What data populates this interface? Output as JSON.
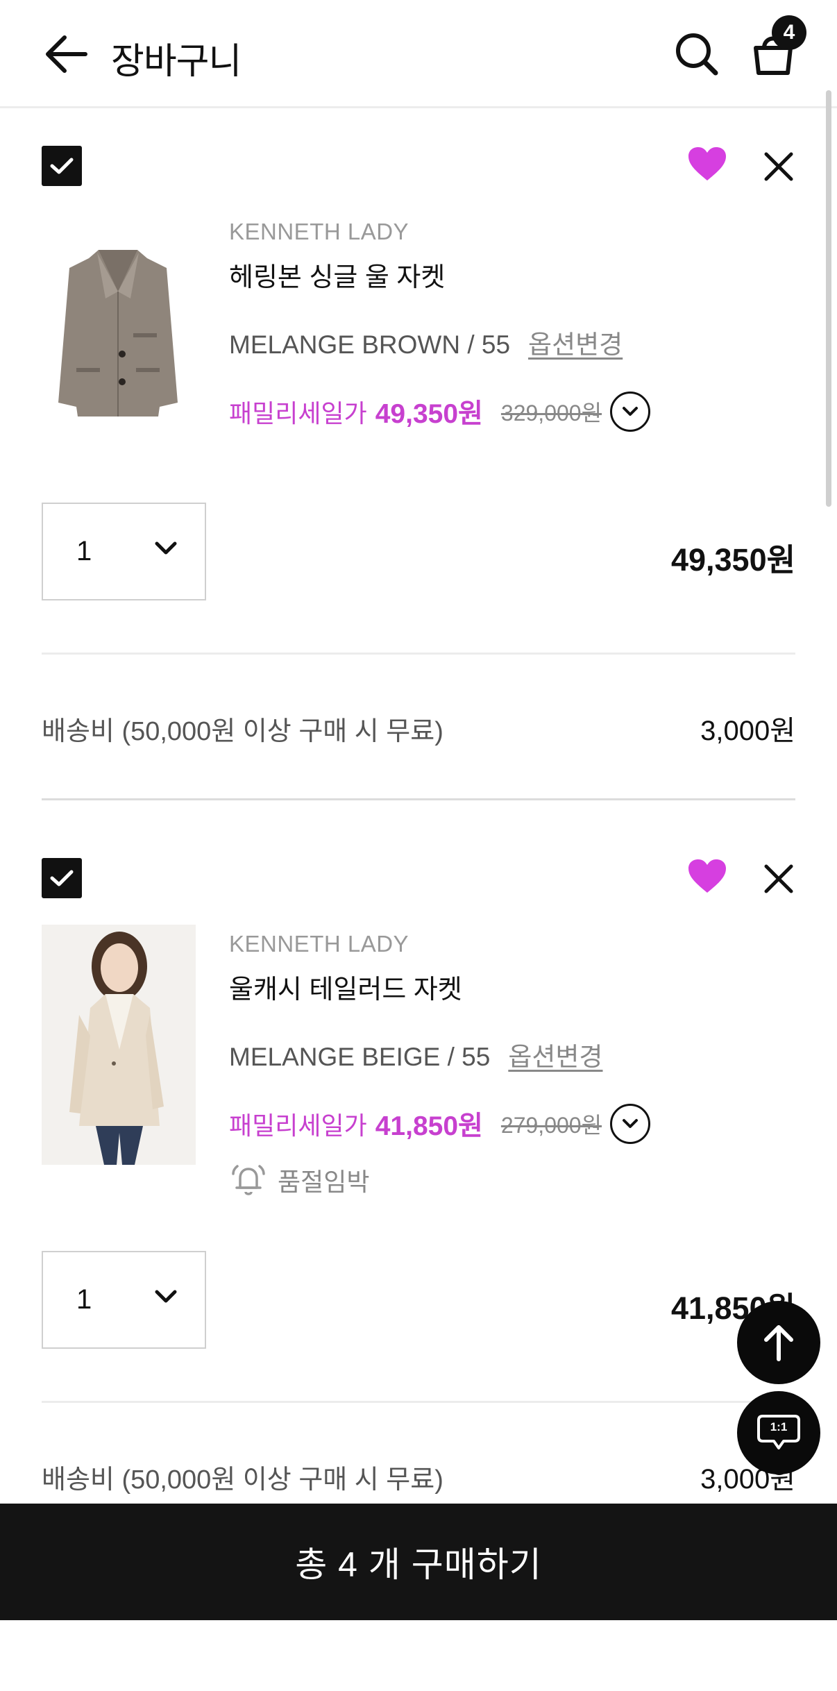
{
  "header": {
    "title": "장바구니",
    "back_icon": "arrow-left-icon",
    "search_icon": "search-icon",
    "cart_icon": "shopping-bag-icon",
    "cart_count": "4"
  },
  "items": [
    {
      "checked": true,
      "wishlisted": true,
      "brand": "KENNETH LADY",
      "name": "헤링본 싱글 울 자켓",
      "option": "MELANGE BROWN / 55",
      "option_change": "옵션변경",
      "sale_label": "패밀리세일가",
      "sale_price": "49,350원",
      "original_price": "329,000원",
      "quantity": "1",
      "line_total": "49,350원",
      "shipping_label": "배송비 (50,000원 이상 구매 시 무료)",
      "shipping_price": "3,000원"
    },
    {
      "checked": true,
      "wishlisted": true,
      "brand": "KENNETH LADY",
      "name": "울캐시 테일러드 자켓",
      "option": "MELANGE BEIGE / 55",
      "option_change": "옵션변경",
      "sale_label": "패밀리세일가",
      "sale_price": "41,850원",
      "original_price": "279,000원",
      "stock_alert": "품절임박",
      "quantity": "1",
      "line_total": "41,850원",
      "shipping_label": "배송비 (50,000원 이상 구매 시 무료)",
      "shipping_price": "3,000원"
    }
  ],
  "floating": {
    "scroll_top_icon": "arrow-up-icon",
    "chat_icon": "chat-bubble-icon",
    "chat_label": "1:1"
  },
  "buy_button": {
    "label": "총 4 개 구매하기"
  },
  "colors": {
    "accent": "#c740cf",
    "heart": "#d63fe0",
    "buy_bar": "#141414"
  }
}
